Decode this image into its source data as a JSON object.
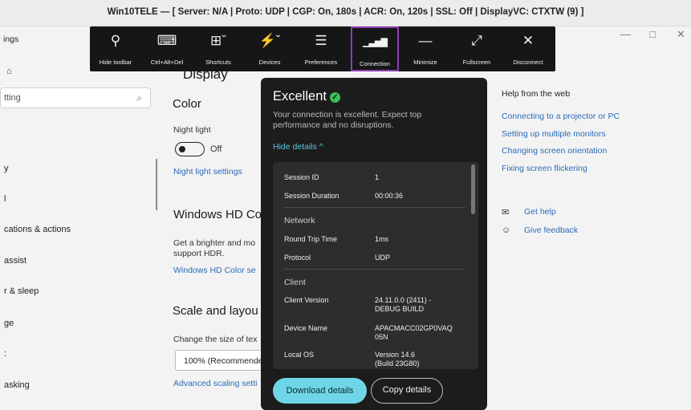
{
  "window": {
    "title": "Win10TELE — [ Server: N/A | Proto: UDP | CGP: On, 180s | ACR: On, 120s | SSL: Off | DisplayVC: CTXTW (9) ]",
    "controls": {
      "minimize": "—",
      "maximize": "□",
      "close": "✕"
    }
  },
  "sidebar": {
    "title": "ings",
    "glyph": "⌂",
    "search_placeholder": "tting",
    "items": [
      {
        "label": "y"
      },
      {
        "label": "l"
      },
      {
        "label": "cations & actions"
      },
      {
        "label": " assist"
      },
      {
        "label": "r & sleep"
      },
      {
        "label": "ge"
      },
      {
        "label": ":"
      },
      {
        "label": "asking"
      }
    ]
  },
  "content": {
    "page_heading": "Display",
    "color_heading": "Color",
    "night_light_label": "Night light",
    "night_light_state": "Off",
    "night_light_settings_link": "Night light settings",
    "hd_heading": "Windows HD Co",
    "hd_desc_line1": "Get a brighter and mo",
    "hd_desc_line2": "support HDR.",
    "hd_link": "Windows HD Color se",
    "scale_heading": "Scale and layou",
    "scale_desc": "Change the size of tex",
    "scale_value": "100% (Recommende",
    "advanced_link": "Advanced scaling setti"
  },
  "right": {
    "help_heading": "Help from the web",
    "links": [
      "Connecting to a projector or PC",
      "Setting up multiple monitors",
      "Changing screen orientation",
      "Fixing screen flickering"
    ],
    "get_help": "Get help",
    "give_feedback": "Give feedback"
  },
  "toolbar": {
    "buttons": [
      {
        "label": "Hide toolbar",
        "icon": "pin-icon",
        "glyph": "⚲"
      },
      {
        "label": "Ctrl+Alt+Del",
        "icon": "keyboard-icon",
        "glyph": "⌨"
      },
      {
        "label": "Shortcuts",
        "icon": "shortcuts-icon",
        "glyph": "⊞ˇ"
      },
      {
        "label": "Devices",
        "icon": "usb-icon",
        "glyph": "⚡ˇ"
      },
      {
        "label": "Preferences",
        "icon": "preferences-icon",
        "glyph": "☰"
      },
      {
        "label": "Connection",
        "icon": "signal-icon",
        "glyph": "▁▃▅▇",
        "active": true
      },
      {
        "label": "Minimize",
        "icon": "minimize-icon",
        "glyph": "—"
      },
      {
        "label": "Fullscreen",
        "icon": "fullscreen-icon",
        "glyph": "⤢"
      },
      {
        "label": "Disconnect",
        "icon": "close-icon",
        "glyph": "✕"
      }
    ]
  },
  "connection_panel": {
    "status": "Excellent",
    "description": "Your connection is excellent. Expect top performance and no disruptions.",
    "hide_details": "Hide details ^",
    "session_id_label": "Session ID",
    "session_id": "1",
    "session_duration_label": "Session Duration",
    "session_duration": "00:00:36",
    "network_section": "Network",
    "rtt_label": "Round Trip Time",
    "rtt": "1ms",
    "protocol_label": "Protocol",
    "protocol": "UDP",
    "client_section": "Client",
    "client_version_label": "Client Version",
    "client_version_line1": "24.11.0.0 (2411) -",
    "client_version_line2": "DEBUG BUILD",
    "device_name_label": "Device Name",
    "device_name_line1": "APACMACC02GP0VAQ",
    "device_name_line2": "05N",
    "local_os_label": "Local OS",
    "local_os_line1": "Version 14.6",
    "local_os_line2": "(Build 23G80)",
    "download_button": "Download details",
    "copy_button": "Copy details"
  },
  "colors": {
    "toolbar_bg": "#161616",
    "panel_bg": "#1c1c1c",
    "active_outline": "#8c3fb2",
    "accent_button": "#6ed6e6",
    "link": "#2a6bb8",
    "success": "#3cbf5a"
  }
}
